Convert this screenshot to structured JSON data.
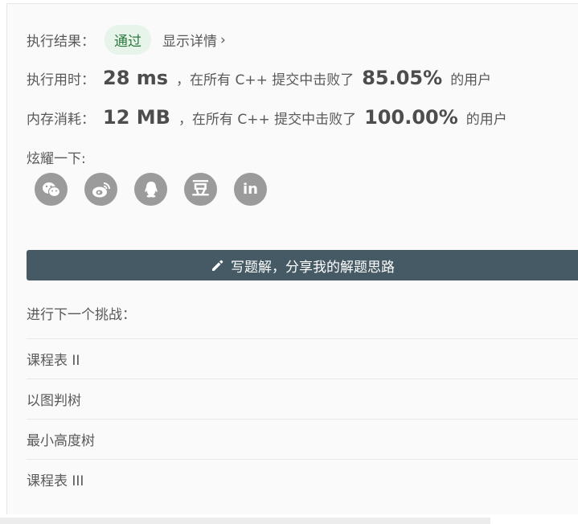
{
  "result": {
    "label": "执行结果：",
    "status": "通过",
    "details_link": "显示详情",
    "details_chevron": "›"
  },
  "runtime": {
    "label": "执行用时：",
    "value": "28 ms",
    "middle_text": "，在所有 C++ 提交中击败了",
    "percent": "85.05%",
    "suffix": "的用户"
  },
  "memory": {
    "label": "内存消耗：",
    "value": "12 MB",
    "middle_text": "，在所有 C++ 提交中击败了",
    "percent": "100.00%",
    "suffix": "的用户"
  },
  "share": {
    "label": "炫耀一下:",
    "icons": [
      "wechat-icon",
      "weibo-icon",
      "qq-icon",
      "douban-icon",
      "linkedin-icon"
    ],
    "douban_glyph": "豆",
    "linkedin_glyph": "in"
  },
  "solution_button": {
    "label": "写题解，分享我的解题思路",
    "icon": "pencil-icon"
  },
  "next_challenge": {
    "title": "进行下一个挑战：",
    "items": [
      "课程表 II",
      "以图判树",
      "最小高度树",
      "课程表 III"
    ]
  },
  "colors": {
    "badge_bg": "#e6f4ea",
    "badge_text": "#2c7a3f",
    "button_bg": "#455a64",
    "icon_bg": "#9b9b9b"
  }
}
